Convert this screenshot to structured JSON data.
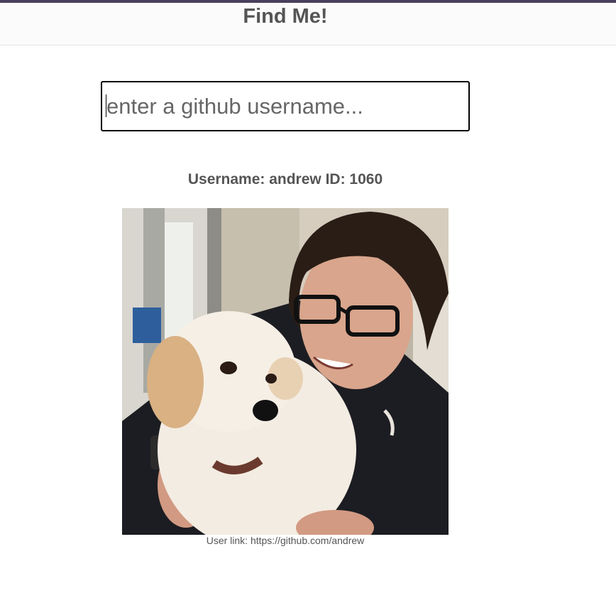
{
  "header": {
    "title": "Find Me!"
  },
  "search": {
    "placeholder": "enter a github username...",
    "value": ""
  },
  "user": {
    "info_text": "Username: andrew ID: 1060",
    "link_label": "User link: ",
    "link_url": "https://github.com/andrew"
  },
  "colors": {
    "accent_bar": "#4a3f5c",
    "text": "#555555"
  }
}
